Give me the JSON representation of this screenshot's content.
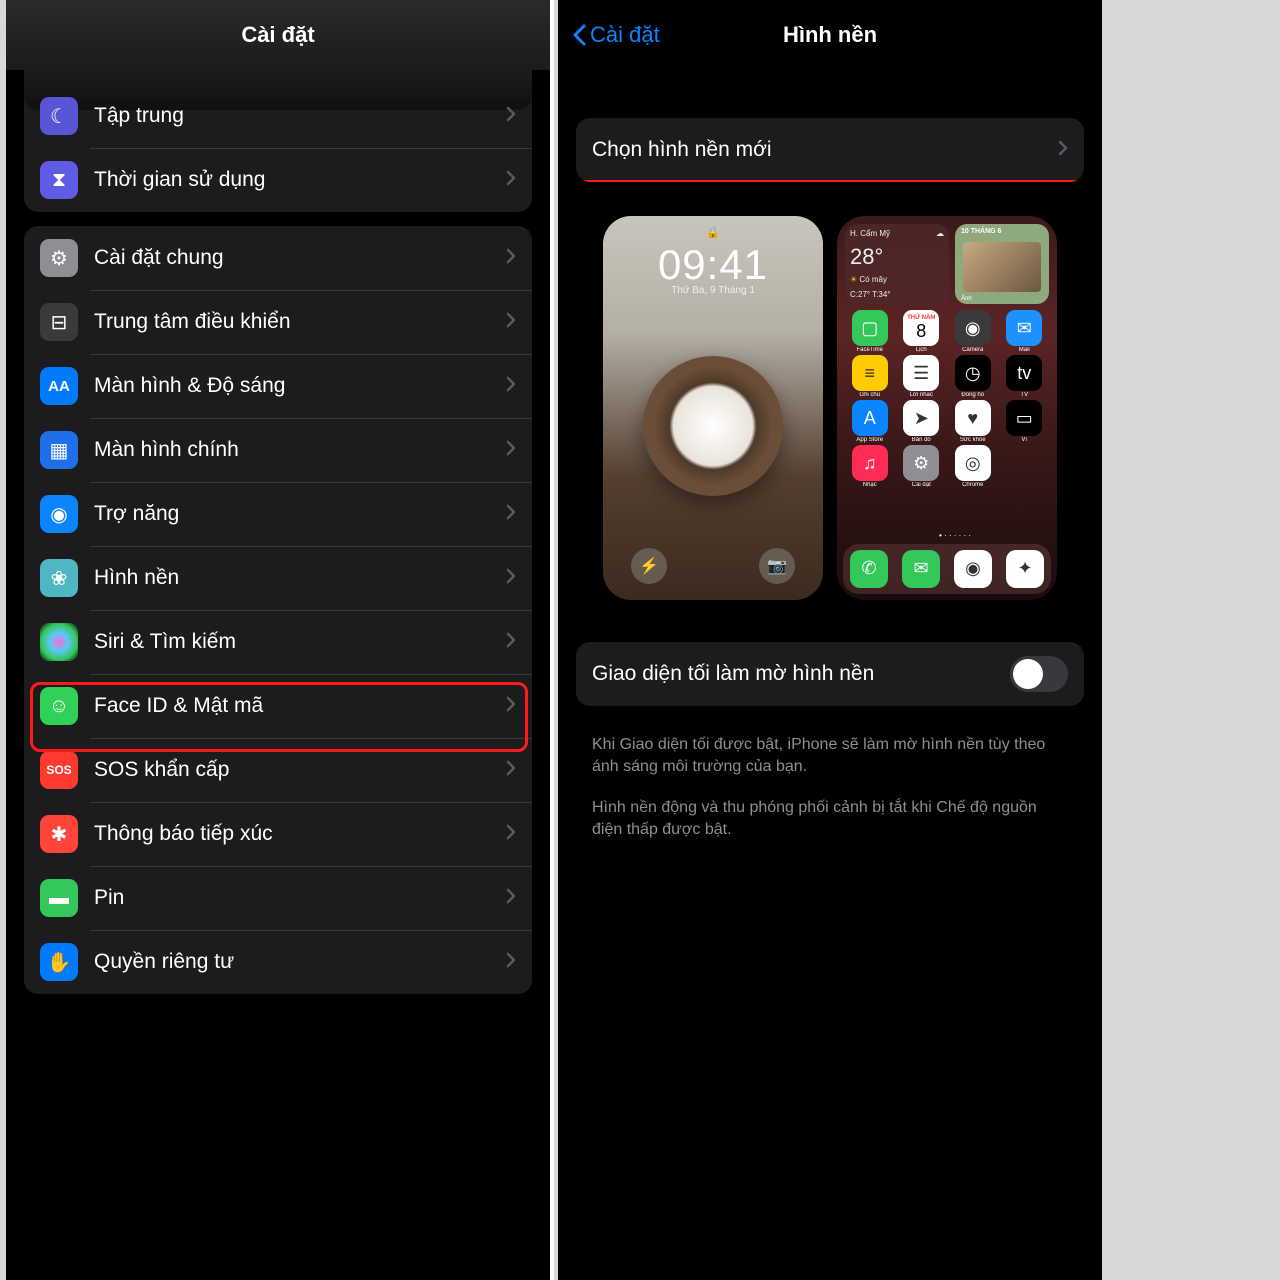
{
  "left": {
    "title": "Cài đặt",
    "group1": [
      {
        "label": "Tập trung",
        "icon": "moon-icon",
        "bg": "bg-purple",
        "glyph": "☾"
      },
      {
        "label": "Thời gian sử dụng",
        "icon": "hourglass-icon",
        "bg": "bg-indigo",
        "glyph": "⧗"
      }
    ],
    "group2": [
      {
        "label": "Cài đặt chung",
        "icon": "gear-icon",
        "bg": "bg-gray",
        "glyph": "⚙"
      },
      {
        "label": "Trung tâm điều khiển",
        "icon": "control-center-icon",
        "bg": "bg-darkgray",
        "glyph": "⊟"
      },
      {
        "label": "Màn hình & Độ sáng",
        "icon": "display-icon",
        "bg": "bg-blue",
        "glyph": "AA"
      },
      {
        "label": "Màn hình chính",
        "icon": "home-screen-icon",
        "bg": "bg-darkblue",
        "glyph": "▦"
      },
      {
        "label": "Trợ năng",
        "icon": "accessibility-icon",
        "bg": "bg-access",
        "glyph": "◉"
      },
      {
        "label": "Hình nền",
        "icon": "wallpaper-icon",
        "bg": "bg-teal",
        "glyph": "❀"
      },
      {
        "label": "Siri & Tìm kiếm",
        "icon": "siri-icon",
        "bg": "bg-siri",
        "glyph": ""
      },
      {
        "label": "Face ID & Mật mã",
        "icon": "faceid-icon",
        "bg": "bg-green",
        "glyph": "☺"
      },
      {
        "label": "SOS khẩn cấp",
        "icon": "sos-icon",
        "bg": "bg-red",
        "glyph": "SOS"
      },
      {
        "label": "Thông báo tiếp xúc",
        "icon": "exposure-icon",
        "bg": "bg-exposure",
        "glyph": "✱"
      },
      {
        "label": "Pin",
        "icon": "battery-icon",
        "bg": "bg-battery",
        "glyph": "▬"
      },
      {
        "label": "Quyền riêng tư",
        "icon": "privacy-icon",
        "bg": "bg-hand",
        "glyph": "✋"
      }
    ]
  },
  "right": {
    "back": "Cài đặt",
    "title": "Hình nền",
    "choose": "Chọn hình nền mới",
    "lock": {
      "time": "09:41",
      "date": "Thứ Ba, 9 Tháng 1"
    },
    "home": {
      "weather_loc": "H. Cẩm Mỹ",
      "weather_temp": "28°",
      "weather_cond": "Có mây",
      "weather_range": "C:27° T:34°",
      "photo_date": "10 THÁNG 6",
      "photo_lbl": "Ảnh",
      "cal_lbl": "THỨ NĂM",
      "cal_num": "8",
      "apps": [
        {
          "l": "FaceTime",
          "c": "#34c759",
          "g": "▢"
        },
        {
          "l": "Lịch",
          "c": "#ffffff",
          "g": ""
        },
        {
          "l": "Camera",
          "c": "#3a3a3c",
          "g": "◉"
        },
        {
          "l": "Mail",
          "c": "#1e90ff",
          "g": "✉"
        },
        {
          "l": "Ghi chú",
          "c": "#ffcc00",
          "g": "≡"
        },
        {
          "l": "Lời nhắc",
          "c": "#ffffff",
          "g": "☰"
        },
        {
          "l": "Đồng hồ",
          "c": "#000000",
          "g": "◷"
        },
        {
          "l": "TV",
          "c": "#000000",
          "g": "tv"
        },
        {
          "l": "App Store",
          "c": "#0a84ff",
          "g": "A"
        },
        {
          "l": "Bản đồ",
          "c": "#ffffff",
          "g": "➤"
        },
        {
          "l": "Sức khỏe",
          "c": "#ffffff",
          "g": "♥"
        },
        {
          "l": "Ví",
          "c": "#000000",
          "g": "▭"
        },
        {
          "l": "Nhạc",
          "c": "#ff2d55",
          "g": "♫"
        },
        {
          "l": "Cài đặt",
          "c": "#8e8e93",
          "g": "⚙"
        },
        {
          "l": "Chrome",
          "c": "#ffffff",
          "g": "◎"
        },
        {
          "l": "",
          "c": "transparent",
          "g": ""
        }
      ],
      "dock": [
        {
          "c": "#34c759",
          "g": "✆"
        },
        {
          "c": "#34c759",
          "g": "✉"
        },
        {
          "c": "#ffffff",
          "g": "◉"
        },
        {
          "c": "#ffffff",
          "g": "✦"
        }
      ]
    },
    "toggle_label": "Giao diện tối làm mờ hình nền",
    "toggle_on": false,
    "footer1": "Khi Giao diện tối được bật, iPhone sẽ làm mờ hình nền tùy theo ánh sáng môi trường của bạn.",
    "footer2": "Hình nền động và thu phóng phối cảnh bị tắt khi Chế độ nguồn điện thấp được bật."
  }
}
